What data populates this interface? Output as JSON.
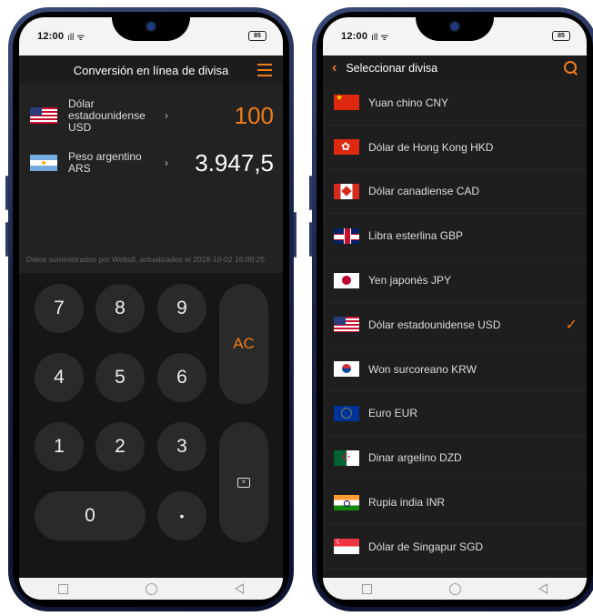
{
  "status_bar": {
    "time": "12:00",
    "signal": "ıll ᯤ",
    "battery": "85"
  },
  "converter": {
    "title": "Conversión en línea de divisa",
    "rows": [
      {
        "name": "Dólar estadounidense USD",
        "amount": "100",
        "flag": "us-flag"
      },
      {
        "name": "Peso argentino ARS",
        "amount": "3.947,5",
        "flag": "ar-flag"
      }
    ],
    "chevron": "›",
    "source_note": "Datos suministrados por Webull, actualizados el 2018-10-02 16:09:25",
    "keys": {
      "k7": "7",
      "k8": "8",
      "k9": "9",
      "k4": "4",
      "k5": "5",
      "k6": "6",
      "k1": "1",
      "k2": "2",
      "k3": "3",
      "k0": "0",
      "dot": "•",
      "ac": "AC",
      "backspace": "×"
    }
  },
  "selector": {
    "title": "Seleccionar divisa",
    "back": "‹",
    "check": "✓",
    "currencies": [
      {
        "label": "Yuan chino CNY",
        "selected": false
      },
      {
        "label": "Dólar de Hong Kong HKD",
        "selected": false
      },
      {
        "label": "Dólar canadiense CAD",
        "selected": false
      },
      {
        "label": "Libra esterlina GBP",
        "selected": false
      },
      {
        "label": "Yen japonés JPY",
        "selected": false
      },
      {
        "label": "Dólar estadounidense USD",
        "selected": true
      },
      {
        "label": "Won surcoreano KRW",
        "selected": false
      },
      {
        "label": "Euro EUR",
        "selected": false
      },
      {
        "label": "Dinar argelino DZD",
        "selected": false
      },
      {
        "label": "Rupia india INR",
        "selected": false
      },
      {
        "label": "Dólar de Singapur SGD",
        "selected": false
      }
    ]
  },
  "colors": {
    "accent": "#f07c1a",
    "background": "#1b1b1b"
  }
}
